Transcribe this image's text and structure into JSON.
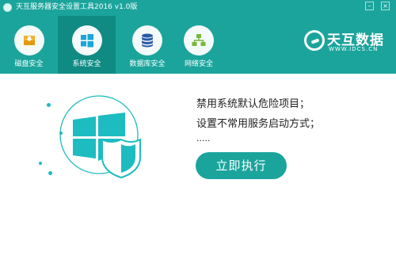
{
  "window": {
    "title": "天互服务器安全设置工具2016 v1.0版"
  },
  "controls": {
    "minimize_icon": "minimize-icon",
    "close_icon": "close-icon"
  },
  "tabs": [
    {
      "label": "磁盘安全",
      "icon": "disk-icon",
      "active": false
    },
    {
      "label": "系统安全",
      "icon": "windows-icon",
      "active": true
    },
    {
      "label": "数据库安全",
      "icon": "database-icon",
      "active": false
    },
    {
      "label": "网络安全",
      "icon": "network-icon",
      "active": false
    }
  ],
  "brand": {
    "name": "天互数据",
    "url": "WWW.IDCS.CN"
  },
  "content": {
    "line1": "禁用系统默认危险项目；",
    "line2": "设置不常用服务启动方式；",
    "line3": ".....",
    "button_label": "立即执行"
  },
  "colors": {
    "header": "#1ba49c",
    "active_tab": "#0f8b84",
    "accent": "#1dbcc0",
    "button": "#1ba49c"
  }
}
